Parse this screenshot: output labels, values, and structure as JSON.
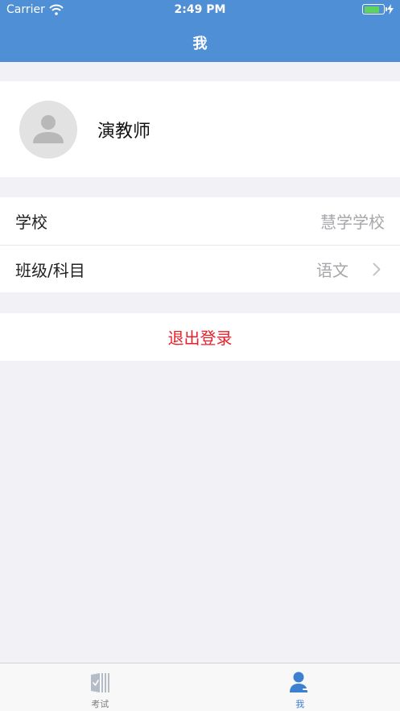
{
  "status_bar": {
    "carrier": "Carrier",
    "time": "2:49 PM",
    "battery_level": 0.8
  },
  "header": {
    "title": "我"
  },
  "profile": {
    "name": "演教师"
  },
  "info": [
    {
      "label": "学校",
      "value": "慧学学校",
      "chevron": false
    },
    {
      "label": "班级/科目",
      "value": "语文",
      "chevron": true
    }
  ],
  "logout": {
    "label": "退出登录"
  },
  "tabs": [
    {
      "label": "考试",
      "icon": "exam-icon",
      "active": false
    },
    {
      "label": "我",
      "icon": "person-icon",
      "active": true
    }
  ],
  "colors": {
    "accent": "#4f8fd5",
    "danger": "#e8202a",
    "tab_active": "#3d7fd0"
  }
}
